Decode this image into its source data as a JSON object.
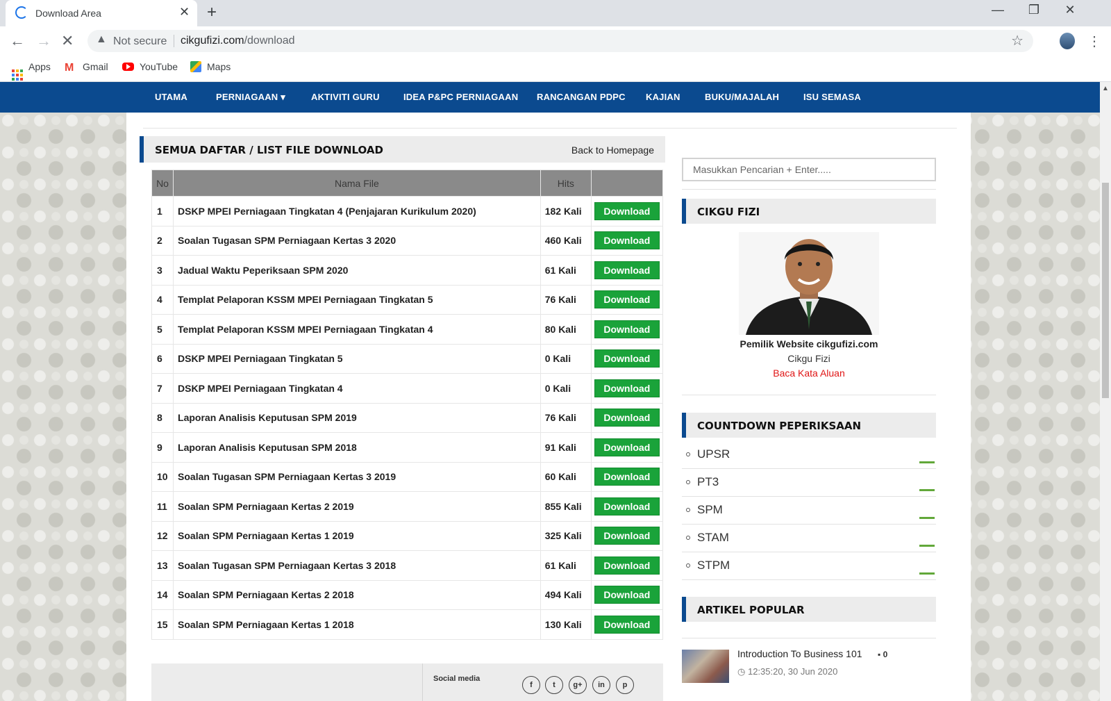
{
  "browser": {
    "tab_title": "Download Area",
    "url_host": "cikgufizi.com",
    "url_path": "/download",
    "security_label": "Not secure",
    "bookmarks": [
      {
        "label": "Apps",
        "icon": "apps-grid-icon"
      },
      {
        "label": "Gmail",
        "icon": "gmail-icon"
      },
      {
        "label": "YouTube",
        "icon": "youtube-icon"
      },
      {
        "label": "Maps",
        "icon": "maps-icon"
      }
    ]
  },
  "nav": {
    "items": [
      "UTAMA",
      "PERNIAGAAN ▾",
      "AKTIVITI GURU",
      "IDEA P&PC PERNIAGAAN",
      "RANCANGAN PDPC",
      "KAJIAN",
      "BUKU/MAJALAH",
      "ISU SEMASA"
    ]
  },
  "main": {
    "section_title": "SEMUA DAFTAR / LIST FILE DOWNLOAD",
    "back_link": "Back to Homepage",
    "columns": [
      "No",
      "Nama File",
      "Hits",
      ""
    ],
    "download_label": "Download",
    "rows": [
      {
        "no": "1",
        "name": "DSKP MPEI Perniagaan Tingkatan 4 (Penjajaran Kurikulum 2020)",
        "hits": "182 Kali"
      },
      {
        "no": "2",
        "name": "Soalan Tugasan SPM Perniagaan Kertas 3 2020",
        "hits": "460 Kali"
      },
      {
        "no": "3",
        "name": "Jadual Waktu Peperiksaan SPM 2020",
        "hits": "61 Kali"
      },
      {
        "no": "4",
        "name": "Templat Pelaporan KSSM MPEI Perniagaan Tingkatan 5",
        "hits": "76 Kali"
      },
      {
        "no": "5",
        "name": "Templat Pelaporan KSSM MPEI Perniagaan Tingkatan 4",
        "hits": "80 Kali"
      },
      {
        "no": "6",
        "name": "DSKP MPEI Perniagaan Tingkatan 5",
        "hits": "0 Kali"
      },
      {
        "no": "7",
        "name": "DSKP MPEI Perniagaan Tingkatan 4",
        "hits": "0 Kali"
      },
      {
        "no": "8",
        "name": "Laporan Analisis Keputusan SPM 2019",
        "hits": "76 Kali"
      },
      {
        "no": "9",
        "name": "Laporan Analisis Keputusan SPM 2018",
        "hits": "91 Kali"
      },
      {
        "no": "10",
        "name": "Soalan Tugasan SPM Perniagaan Kertas 3 2019",
        "hits": "60 Kali"
      },
      {
        "no": "11",
        "name": "Soalan SPM Perniagaan Kertas 2 2019",
        "hits": "855 Kali"
      },
      {
        "no": "12",
        "name": "Soalan SPM Perniagaan Kertas 1 2019",
        "hits": "325 Kali"
      },
      {
        "no": "13",
        "name": "Soalan Tugasan SPM Perniagaan Kertas 3 2018",
        "hits": "61 Kali"
      },
      {
        "no": "14",
        "name": "Soalan SPM Perniagaan Kertas 2 2018",
        "hits": "494 Kali"
      },
      {
        "no": "15",
        "name": "Soalan SPM Perniagaan Kertas 1 2018",
        "hits": "130 Kali"
      }
    ],
    "social_label": "Social media",
    "social_icons": [
      "f",
      "t",
      "g+",
      "in",
      "p"
    ]
  },
  "sidebar": {
    "search_placeholder": "Masukkan Pencarian + Enter.....",
    "profile_title": "CIKGU FIZI",
    "owner_caption": "Pemilik Website cikgufizi.com",
    "owner_name": "Cikgu Fizi",
    "owner_link": "Baca Kata Aluan",
    "countdown_title": "COUNTDOWN PEPERIKSAAN",
    "countdown_items": [
      "UPSR",
      "PT3",
      "SPM",
      "STAM",
      "STPM"
    ],
    "popular_title": "ARTIKEL POPULAR",
    "popular_article": {
      "title": "Introduction To Business 101",
      "comments": "0",
      "date": "12:35:20, 30 Jun 2020"
    }
  },
  "colors": {
    "nav_bg": "#0b4a8f",
    "download_button": "#1aa33a",
    "link_red": "#e01515"
  }
}
